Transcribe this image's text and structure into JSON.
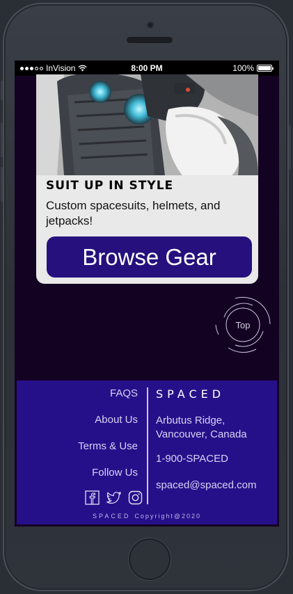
{
  "statusbar": {
    "carrier": "InVision",
    "time": "8:00 PM",
    "battery": "100%"
  },
  "card": {
    "title": "Suit up in style",
    "text": "Custom spacesuits, helmets, and jetpacks!",
    "button_label": "Browse Gear",
    "image_icon": "spacesuit-helmet-photo"
  },
  "top_button": {
    "label": "Top"
  },
  "footer": {
    "links": [
      {
        "label": "FAQS"
      },
      {
        "label": "About Us"
      },
      {
        "label": "Terms & Use"
      },
      {
        "label": "Follow Us"
      }
    ],
    "brand": "SPACED",
    "address_line1": "Arbutus Ridge,",
    "address_line2": "Vancouver, Canada",
    "phone": "1-900-SPACED",
    "email": "spaced@spaced.com",
    "socials": [
      "facebook-icon",
      "twitter-icon",
      "instagram-icon"
    ],
    "copyright_brand": "SPACED",
    "copyright_text": "Copyright@2020"
  },
  "colors": {
    "background": "#140223",
    "footer": "#26108a",
    "button": "#25107d",
    "card": "#e9e9e9"
  }
}
